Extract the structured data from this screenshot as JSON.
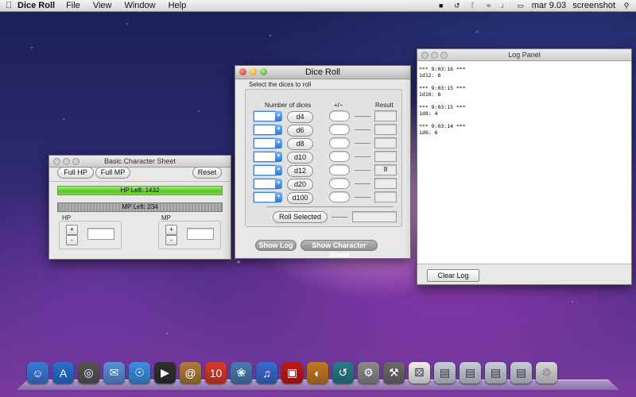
{
  "menubar": {
    "app_name": "Dice Roll",
    "menus": [
      "File",
      "View",
      "Window",
      "Help"
    ],
    "clock": "mar 9.03",
    "user": "screenshot"
  },
  "char_sheet": {
    "title": "Basic Character Sheet",
    "full_hp": "Full HP",
    "full_mp": "Full MP",
    "reset": "Reset",
    "hp_bar_text": "HP Left: 1432",
    "mp_bar_text": "MP Left: 234",
    "hp_label": "HP",
    "mp_label": "MP",
    "plus": "+",
    "minus": "-",
    "hp_value": "",
    "mp_value": "",
    "hp_bar_color": "#6fd23a",
    "mp_bar_color": "#8a8a8a"
  },
  "dice_roll": {
    "title": "Dice Roll",
    "instruction": "Select the dices to roll",
    "col_number": "Number of dices",
    "col_mod": "+/−",
    "col_result": "Result",
    "rows": [
      {
        "die": "d4",
        "number": "",
        "mod": "",
        "result": ""
      },
      {
        "die": "d6",
        "number": "",
        "mod": "",
        "result": ""
      },
      {
        "die": "d8",
        "number": "",
        "mod": "",
        "result": ""
      },
      {
        "die": "d10",
        "number": "",
        "mod": "",
        "result": ""
      },
      {
        "die": "d12",
        "number": "",
        "mod": "",
        "result": "8"
      },
      {
        "die": "d20",
        "number": "",
        "mod": "",
        "result": ""
      },
      {
        "die": "d100",
        "number": "",
        "mod": "",
        "result": ""
      }
    ],
    "roll_selected": "Roll Selected",
    "roll_selected_result": "",
    "show_log": "Show Log",
    "show_char_sheet": "Show Character Sheet"
  },
  "log_panel": {
    "title": "Log Panel",
    "text": "*** 9:03:16 ***\n1d12: 8\n\n*** 9:03:15 ***\n1d10: 8\n\n*** 9:03:15 ***\n1d8: 4\n\n*** 9:03:14 ***\n1d6: 6",
    "clear_log": "Clear Log"
  },
  "dock": {
    "items": [
      {
        "name": "finder-icon",
        "color": "#3a7bd5",
        "glyph": "☺"
      },
      {
        "name": "app-store-icon",
        "color": "#2a6fd0",
        "glyph": "A"
      },
      {
        "name": "dashboard-icon",
        "color": "#555555",
        "glyph": "◎"
      },
      {
        "name": "mail-icon",
        "color": "#5a8fd8",
        "glyph": "✉"
      },
      {
        "name": "safari-icon",
        "color": "#3a8fe0",
        "glyph": "☉"
      },
      {
        "name": "facetime-icon",
        "color": "#2f2f2f",
        "glyph": "▶"
      },
      {
        "name": "address-book-icon",
        "color": "#b07a3a",
        "glyph": "@"
      },
      {
        "name": "ical-icon",
        "color": "#d83a2a",
        "glyph": "10"
      },
      {
        "name": "iphoto-icon",
        "color": "#4a7ab0",
        "glyph": "❀"
      },
      {
        "name": "itunes-icon",
        "color": "#3a6ad0",
        "glyph": "♫"
      },
      {
        "name": "photo-booth-icon",
        "color": "#c01818",
        "glyph": "▣"
      },
      {
        "name": "iphoto-camera-icon",
        "color": "#c07a20",
        "glyph": "◐"
      },
      {
        "name": "time-machine-icon",
        "color": "#2a7a8a",
        "glyph": "↺"
      },
      {
        "name": "system-preferences-icon",
        "color": "#8a8a8a",
        "glyph": "⚙"
      },
      {
        "name": "utilities-icon",
        "color": "#6a6a6a",
        "glyph": "⚒"
      },
      {
        "name": "dice-roll-icon",
        "color": "#eeeeee",
        "glyph": "⚄"
      },
      {
        "name": "applications-folder-icon",
        "color": "#c8ccd8",
        "glyph": "▤"
      },
      {
        "name": "documents-folder-icon",
        "color": "#c8ccd8",
        "glyph": "▤"
      },
      {
        "name": "downloads-folder-icon",
        "color": "#c8ccd8",
        "glyph": "▤"
      },
      {
        "name": "stack-folder-icon",
        "color": "#c8ccd8",
        "glyph": "▤"
      },
      {
        "name": "trash-icon",
        "color": "#d6d6d6",
        "glyph": "♲"
      }
    ]
  }
}
